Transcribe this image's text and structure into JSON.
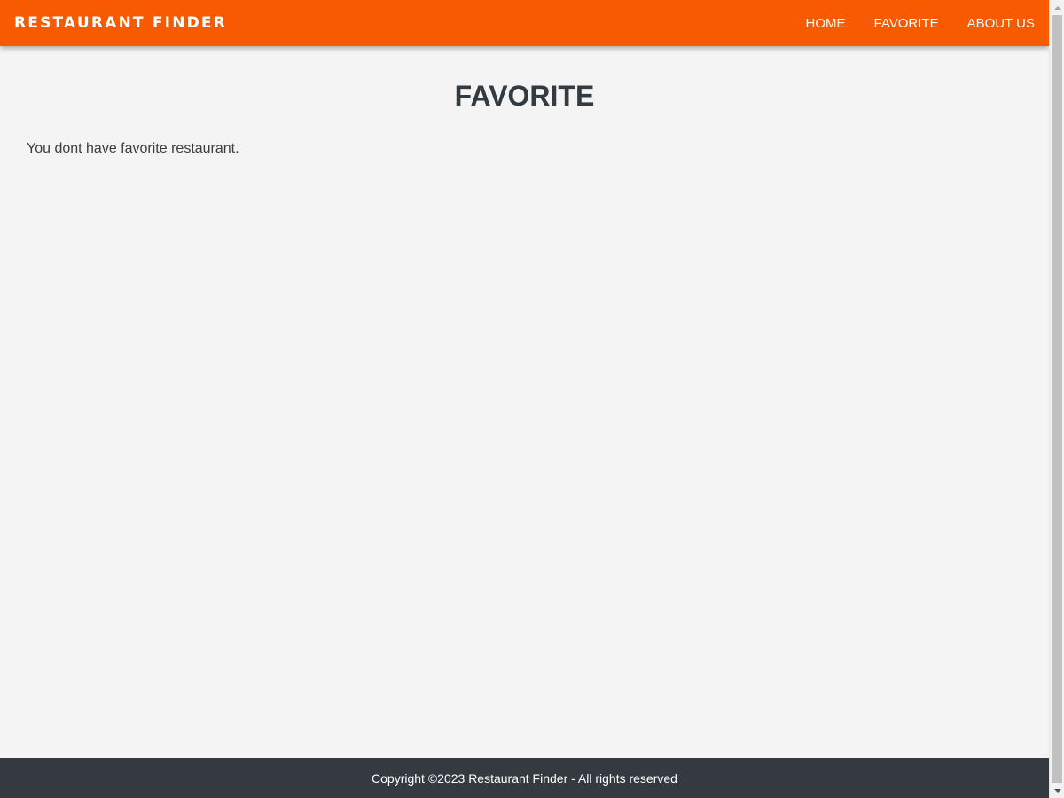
{
  "header": {
    "brand": "RESTAURANT FINDER",
    "nav": [
      {
        "label": "HOME"
      },
      {
        "label": "FAVORITE"
      },
      {
        "label": "ABOUT US"
      }
    ],
    "background_color": "#f75a00"
  },
  "main": {
    "title": "FAVORITE",
    "empty_message": "You dont have favorite restaurant."
  },
  "footer": {
    "copyright": "Copyright ©2023 Restaurant Finder - All rights reserved",
    "background_color": "#343a40"
  }
}
